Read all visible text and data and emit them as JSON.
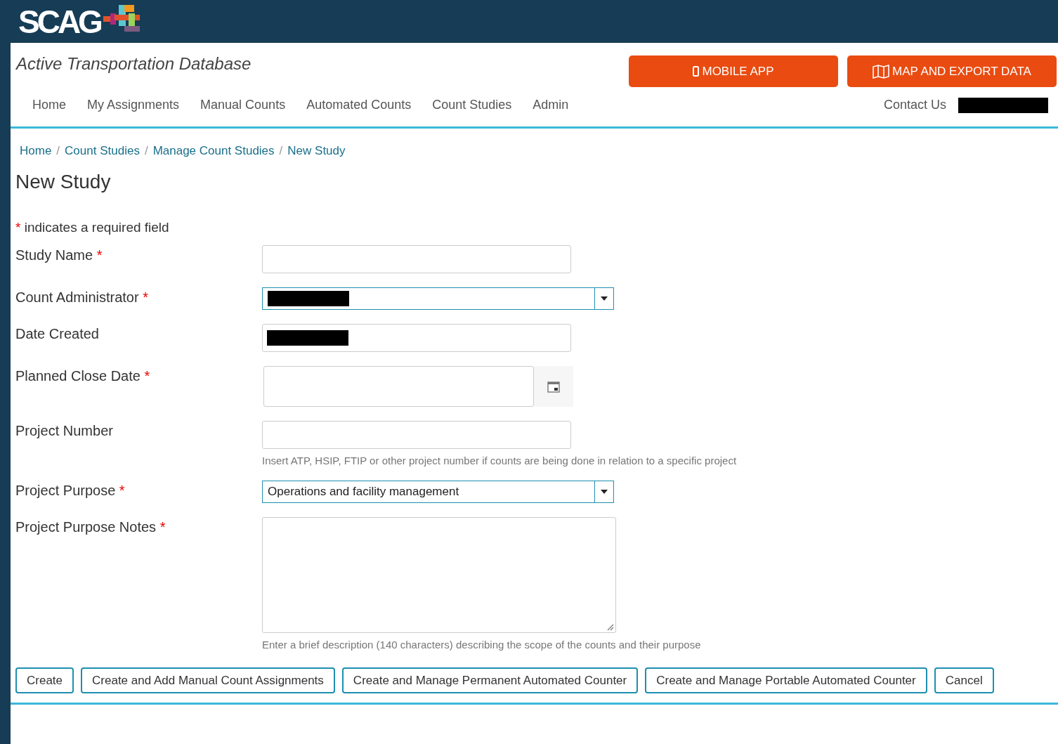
{
  "logo": {
    "text": "SCAG"
  },
  "site_title": "Active Transportation Database",
  "header_buttons": [
    {
      "kind": "phone",
      "label": "MOBILE APP"
    },
    {
      "kind": "map",
      "label": "MAP AND EXPORT DATA"
    }
  ],
  "nav": {
    "items": [
      {
        "label": "Home"
      },
      {
        "label": "My Assignments"
      },
      {
        "label": "Manual Counts"
      },
      {
        "label": "Automated Counts"
      },
      {
        "label": "Count Studies"
      },
      {
        "label": "Admin"
      }
    ],
    "contact": "Contact Us",
    "user_redacted": true
  },
  "breadcrumb": [
    {
      "kind": "link",
      "label": "Home"
    },
    {
      "kind": "separator",
      "label": "/"
    },
    {
      "kind": "link",
      "label": "Count Studies"
    },
    {
      "kind": "separator",
      "label": "/"
    },
    {
      "kind": "link",
      "label": "Manage Count Studies"
    },
    {
      "kind": "separator",
      "label": "/"
    },
    {
      "kind": "link",
      "label": "New Study"
    }
  ],
  "page_title": "New Study",
  "required_note": {
    "mark": "*",
    "text": "indicates a required field"
  },
  "fields": [
    {
      "kind": "text",
      "label": "Study Name",
      "required": true
    },
    {
      "kind": "select",
      "label": "Count Administrator",
      "required": true,
      "redacted": true
    },
    {
      "kind": "text",
      "label": "Date Created",
      "required": false,
      "redacted": true
    },
    {
      "kind": "date",
      "label": "Planned Close Date",
      "required": true
    },
    {
      "kind": "text",
      "label": "Project Number",
      "required": false,
      "help": "Insert ATP, HSIP, FTIP or other project number if counts are being done in relation to a specific project"
    },
    {
      "kind": "select",
      "label": "Project Purpose",
      "required": true,
      "value": "Operations and facility management"
    },
    {
      "kind": "textarea",
      "label": "Project Purpose Notes",
      "required": true,
      "help": "Enter a brief description (140 characters) describing the scope of the counts and their purpose"
    }
  ],
  "buttons": [
    {
      "label": "Create"
    },
    {
      "label": "Create and Add Manual Count Assignments"
    },
    {
      "label": "Create and Manage Permanent Automated Counter"
    },
    {
      "label": "Create and Manage Portable Automated Counter"
    },
    {
      "label": "Cancel"
    }
  ]
}
